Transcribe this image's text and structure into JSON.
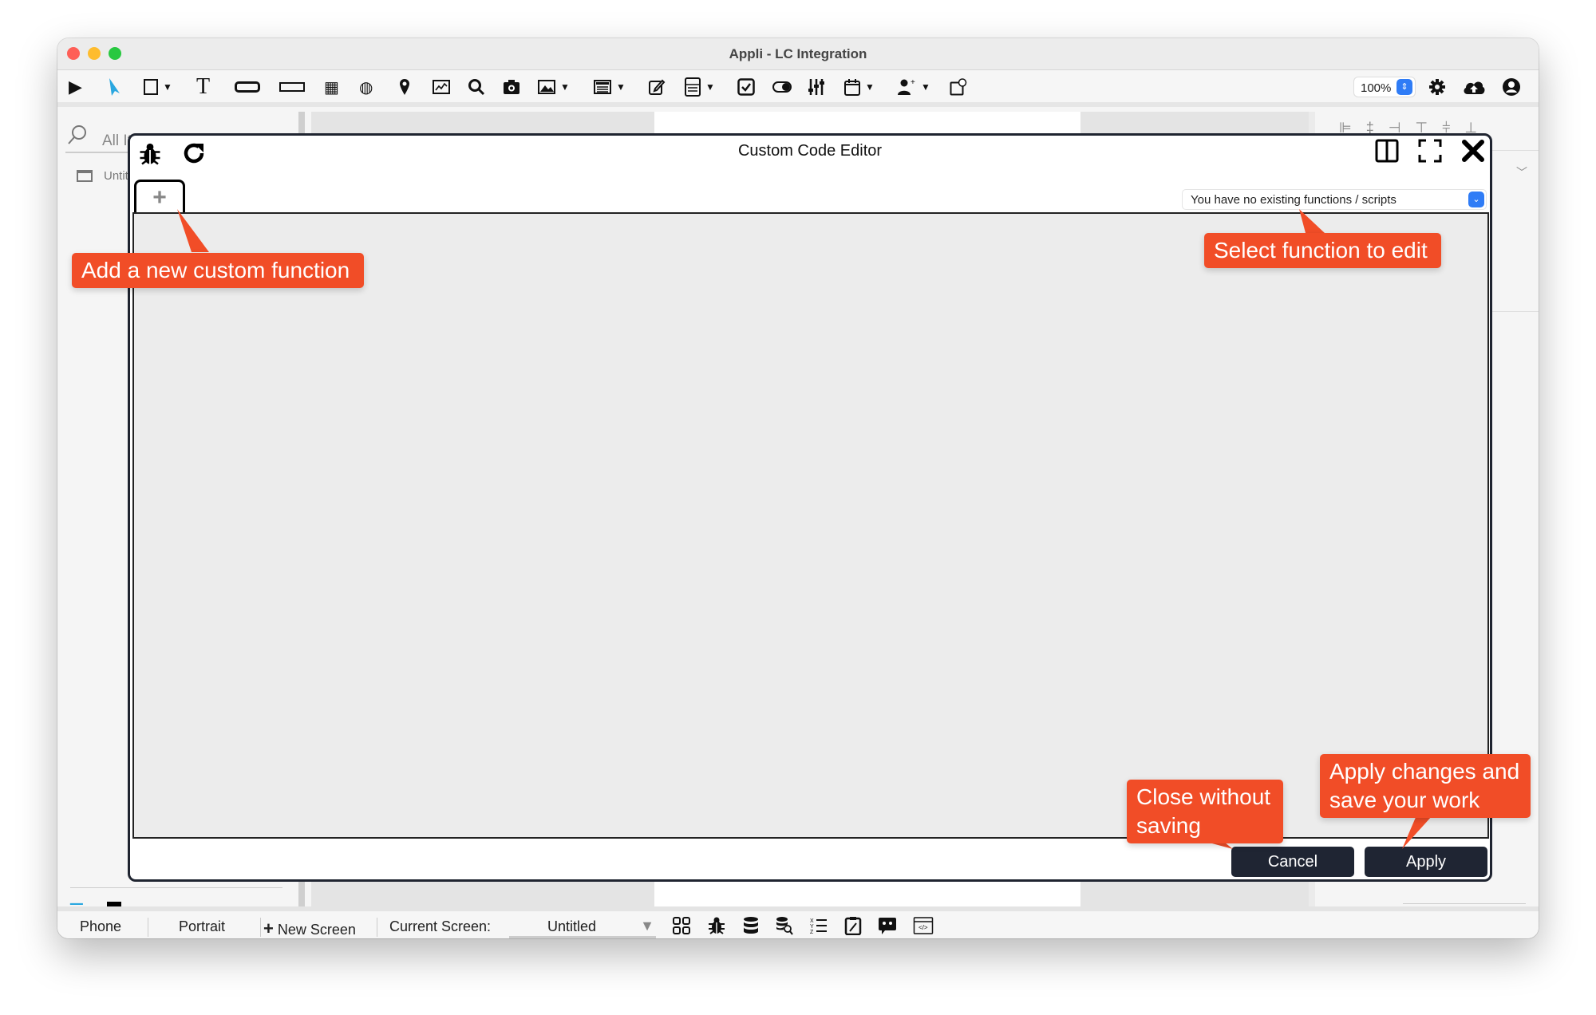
{
  "window": {
    "title": "Appli - LC Integration"
  },
  "toolbar": {
    "tools": [
      {
        "name": "play",
        "glyph": "▶"
      },
      {
        "name": "pointer",
        "glyph": "➤"
      },
      {
        "name": "rectangle",
        "glyph": "☐"
      },
      {
        "name": "text",
        "glyph": "T"
      },
      {
        "name": "button",
        "glyph": "▭"
      },
      {
        "name": "input-field",
        "glyph": "▭"
      },
      {
        "name": "grid",
        "glyph": "▦"
      },
      {
        "name": "globe",
        "glyph": "🌍"
      },
      {
        "name": "map-pin",
        "glyph": "📍"
      },
      {
        "name": "chart",
        "glyph": "📈"
      },
      {
        "name": "search",
        "glyph": "🔍"
      },
      {
        "name": "camera",
        "glyph": "📷"
      },
      {
        "name": "image",
        "glyph": "🖼"
      },
      {
        "name": "list",
        "glyph": "☰"
      },
      {
        "name": "edit",
        "glyph": "✎"
      },
      {
        "name": "form",
        "glyph": "☷"
      },
      {
        "name": "checkbox",
        "glyph": "☑"
      },
      {
        "name": "toggle",
        "glyph": "◉"
      },
      {
        "name": "sliders",
        "glyph": "⫶"
      },
      {
        "name": "calendar",
        "glyph": "📅"
      },
      {
        "name": "add-user",
        "glyph": "👤"
      },
      {
        "name": "popup",
        "glyph": "⧉"
      }
    ],
    "zoom_value": "100%",
    "settings_icon": "⚙",
    "cloud_upload_icon": "☁",
    "account_icon": "●"
  },
  "sidebar": {
    "search_placeholder": "All Items",
    "tree_item": "Untitled"
  },
  "right_panel": {
    "align_icons": [
      "⊫",
      "‡",
      "⊣",
      "⊤",
      "⫩",
      "⊥"
    ]
  },
  "editor": {
    "title": "Custom Code Editor",
    "add_tab_label": "+",
    "function_select_value": "You have no existing functions / scripts",
    "cancel_label": "Cancel",
    "apply_label": "Apply"
  },
  "callouts": {
    "add_function": "Add a new custom function",
    "select_function": "Select function to edit",
    "close_without_saving": "Close without saving",
    "apply_changes": "Apply changes and save your work",
    "color": "#f14d27"
  },
  "bottombar": {
    "device": "Phone",
    "orientation": "Portrait",
    "new_screen": "New Screen",
    "current_screen_label": "Current Screen:",
    "current_screen_value": "Untitled"
  }
}
